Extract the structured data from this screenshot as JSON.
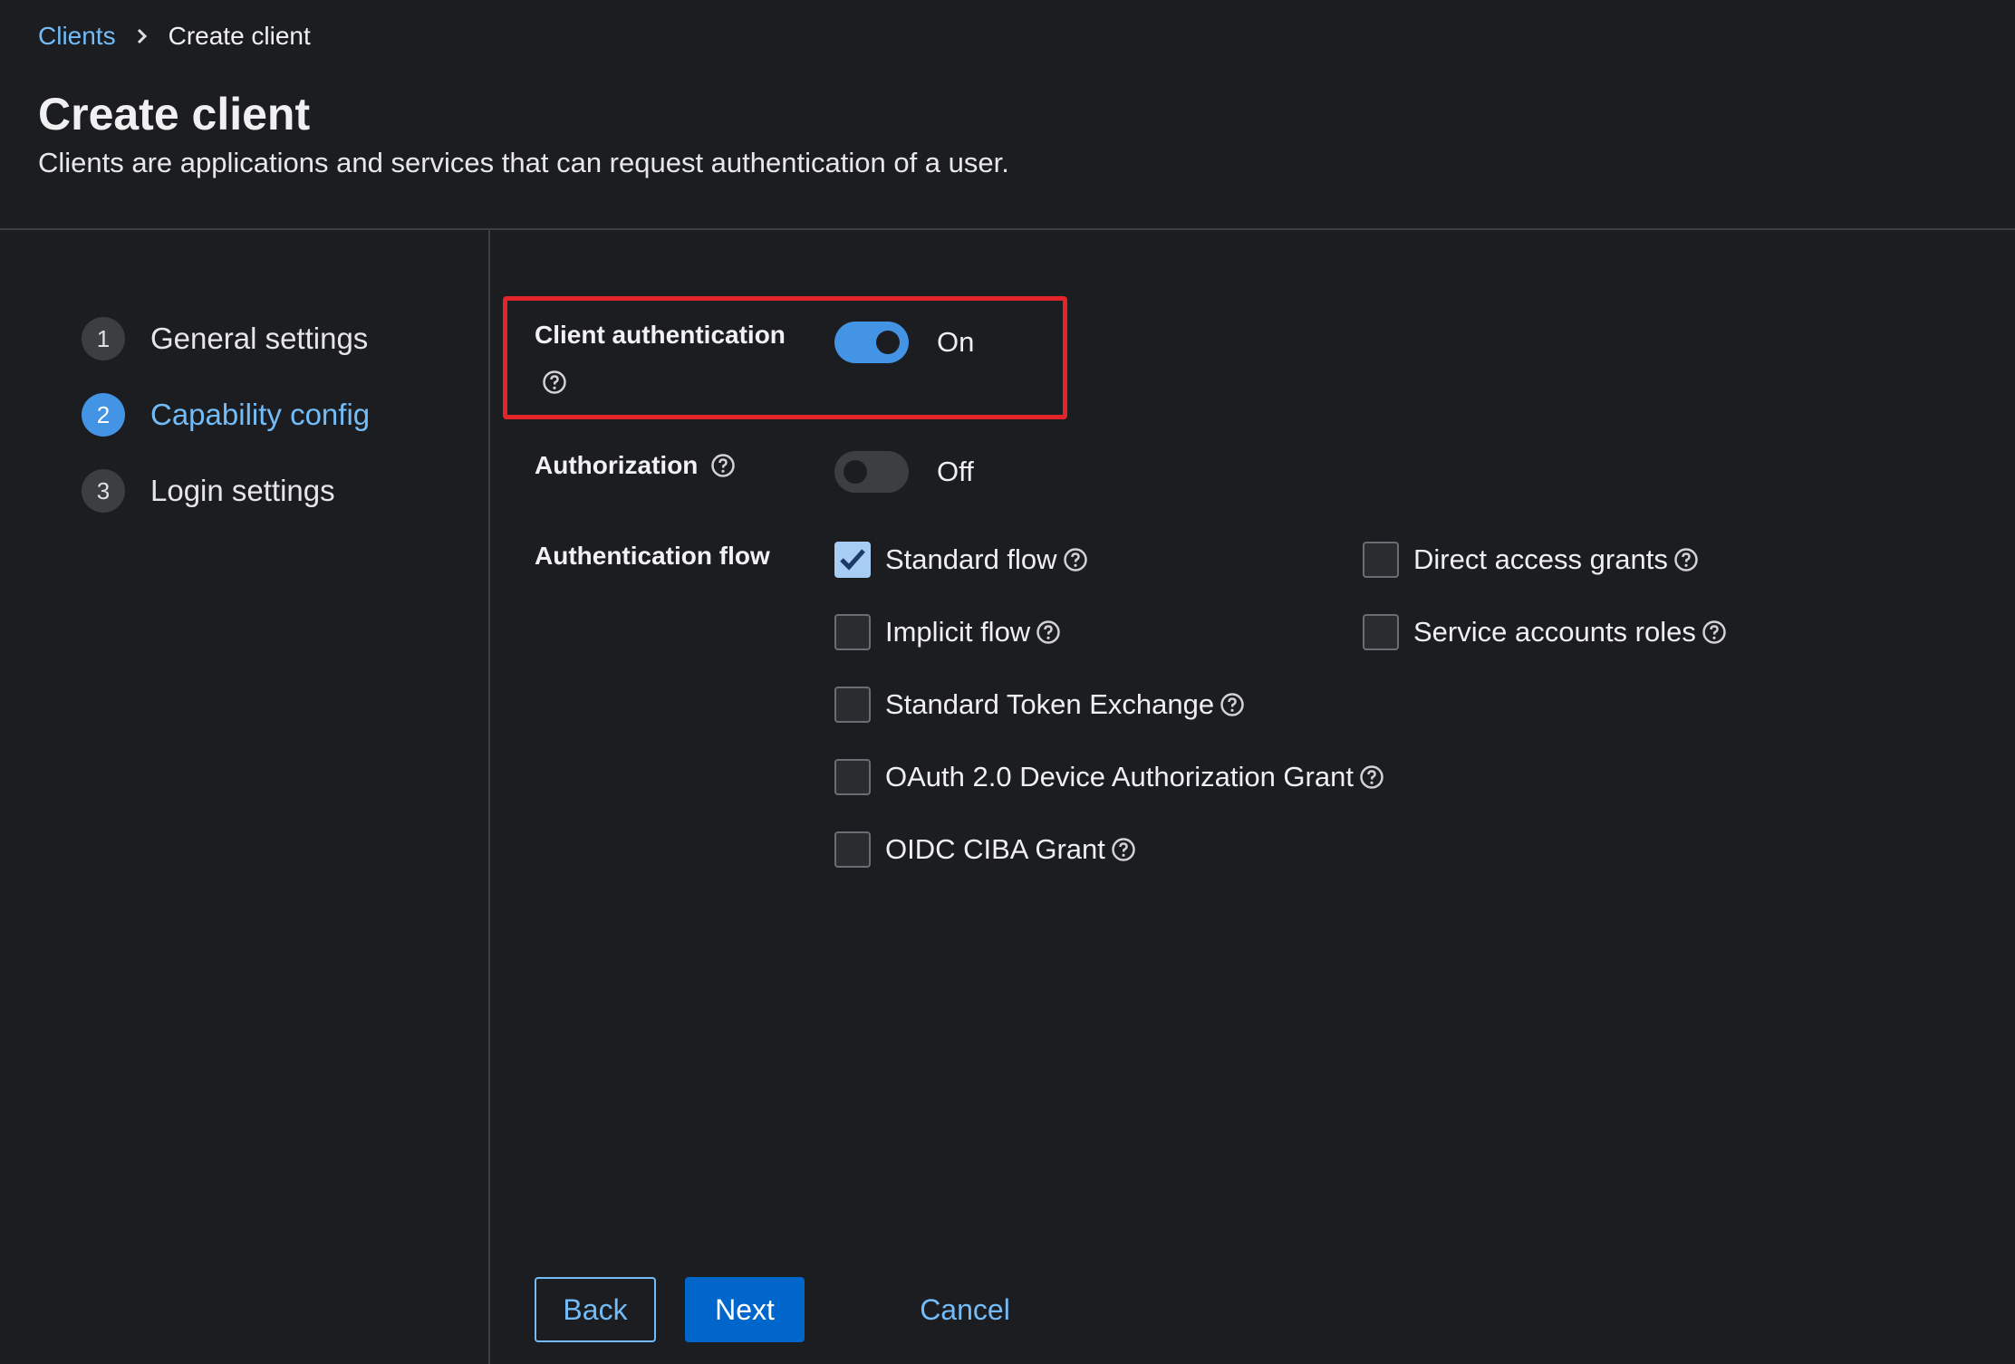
{
  "breadcrumb": {
    "parent": "Clients",
    "current": "Create client"
  },
  "header": {
    "title": "Create client",
    "description": "Clients are applications and services that can request authentication of a user."
  },
  "wizard": {
    "steps": [
      {
        "number": "1",
        "label": "General settings"
      },
      {
        "number": "2",
        "label": "Capability config"
      },
      {
        "number": "3",
        "label": "Login settings"
      }
    ],
    "active_step": 2
  },
  "form": {
    "client_authentication": {
      "label": "Client authentication",
      "state_text": "On",
      "enabled": true
    },
    "authorization": {
      "label": "Authorization",
      "state_text": "Off",
      "enabled": false
    },
    "authentication_flow": {
      "label": "Authentication flow",
      "options": [
        {
          "label": "Standard flow",
          "checked": true
        },
        {
          "label": "Direct access grants",
          "checked": false
        },
        {
          "label": "Implicit flow",
          "checked": false
        },
        {
          "label": "Service accounts roles",
          "checked": false
        },
        {
          "label": "Standard Token Exchange",
          "checked": false
        },
        {
          "label": "OAuth 2.0 Device Authorization Grant",
          "checked": false
        },
        {
          "label": "OIDC CIBA Grant",
          "checked": false
        }
      ]
    }
  },
  "actions": {
    "back": "Back",
    "next": "Next",
    "cancel": "Cancel"
  },
  "colors": {
    "background": "#1b1d21",
    "accent": "#73bcf7",
    "primary_button": "#0066cc",
    "switch_on": "#4394e5",
    "highlight": "#e3242b"
  }
}
